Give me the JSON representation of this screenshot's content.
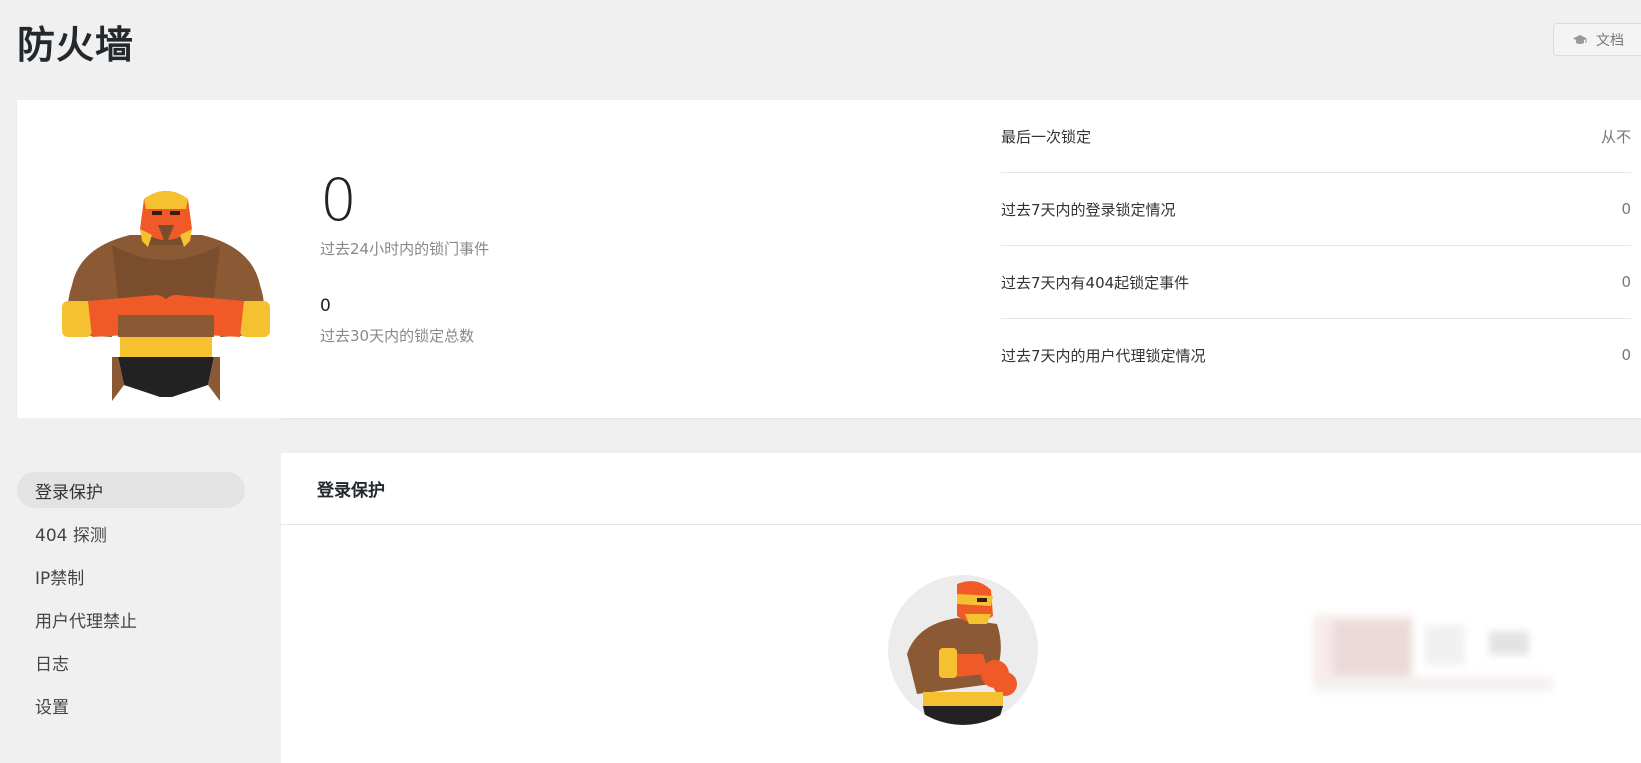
{
  "page": {
    "title": "防火墙",
    "docs_button": {
      "label": "文档",
      "icon": "graduation-cap-icon"
    }
  },
  "summary": {
    "lockouts_24h": {
      "value": "0",
      "label": "过去24小时内的锁门事件"
    },
    "lockouts_30d": {
      "value": "0",
      "label": "过去30天内的锁定总数"
    },
    "details": [
      {
        "label": "最后一次锁定",
        "value": "从不"
      },
      {
        "label": "过去7天内的登录锁定情况",
        "value": "0"
      },
      {
        "label": "过去7天内有404起锁定事件",
        "value": "0"
      },
      {
        "label": "过去7天内的用户代理锁定情况",
        "value": "0"
      }
    ]
  },
  "sidebar": {
    "items": [
      {
        "label": "登录保护",
        "active": true
      },
      {
        "label": "404 探测",
        "active": false
      },
      {
        "label": "IP禁制",
        "active": false
      },
      {
        "label": "用户代理禁止",
        "active": false
      },
      {
        "label": "日志",
        "active": false
      },
      {
        "label": "设置",
        "active": false
      }
    ]
  },
  "panel": {
    "title": "登录保护"
  },
  "colors": {
    "mask_orange": "#f05a28",
    "mask_yellow": "#f6c131",
    "skin_brown": "#8b5a35",
    "trunks_black": "#222222"
  }
}
